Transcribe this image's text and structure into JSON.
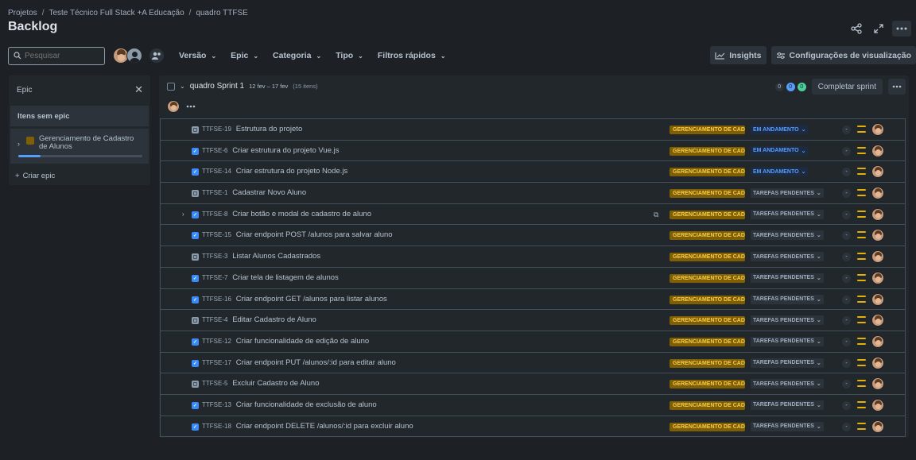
{
  "breadcrumb": [
    "Projetos",
    "Teste Técnico Full Stack +A Educação",
    "quadro TTFSE"
  ],
  "page_title": "Backlog",
  "search": {
    "placeholder": "Pesquisar",
    "value": ""
  },
  "filters": [
    "Versão",
    "Epic",
    "Categoria",
    "Tipo",
    "Filtros rápidos"
  ],
  "toolbar_right": {
    "insights": "Insights",
    "view_settings": "Configurações de visualização"
  },
  "epic_panel": {
    "title": "Epic",
    "no_epic": "Itens sem epic",
    "epics": [
      {
        "name": "Gerenciamento de Cadastro de Alunos",
        "color": "#7f5f01",
        "progress": 0.18
      }
    ],
    "create_label": "Criar epic"
  },
  "sprint": {
    "name": "quadro Sprint 1",
    "dates": "12 fev – 17 fev",
    "count": "(15 itens)",
    "counts": {
      "todo": "0",
      "in_progress": "0",
      "done": "0"
    },
    "complete_label": "Completar sprint"
  },
  "issues": [
    {
      "key": "TTFSE-19",
      "type": "story",
      "summary": "Estrutura do projeto",
      "epic": "GERENCIAMENTO DE CADASTRO DE ALUNOS",
      "status": "EM ANDAMENTO",
      "status_kind": "prog",
      "estimate": "-"
    },
    {
      "key": "TTFSE-6",
      "type": "task",
      "summary": "Criar estrutura do projeto Vue.js",
      "epic": "GERENCIAMENTO DE CADASTRO DE ALUNOS",
      "status": "EM ANDAMENTO",
      "status_kind": "prog",
      "estimate": "-"
    },
    {
      "key": "TTFSE-14",
      "type": "task",
      "summary": "Criar estrutura do projeto Node.js",
      "epic": "GERENCIAMENTO DE CADASTRO DE ALUNOS",
      "status": "EM ANDAMENTO",
      "status_kind": "prog",
      "estimate": "-"
    },
    {
      "key": "TTFSE-1",
      "type": "story",
      "summary": "Cadastrar Novo Aluno",
      "epic": "GERENCIAMENTO DE CADASTRO DE ALUNOS",
      "status": "TAREFAS PENDENTES",
      "status_kind": "todo",
      "estimate": "-"
    },
    {
      "key": "TTFSE-8",
      "type": "task",
      "summary": "Criar botão e modal de cadastro de aluno",
      "epic": "GERENCIAMENTO DE CADASTRO DE ALUNOS",
      "status": "TAREFAS PENDENTES",
      "status_kind": "todo",
      "estimate": "-",
      "expandable": true,
      "has_subtasks": true
    },
    {
      "key": "TTFSE-15",
      "type": "task",
      "summary": "Criar endpoint POST /alunos para salvar aluno",
      "epic": "GERENCIAMENTO DE CADASTRO DE ALUNOS",
      "status": "TAREFAS PENDENTES",
      "status_kind": "todo",
      "estimate": "-"
    },
    {
      "key": "TTFSE-3",
      "type": "story",
      "summary": "Listar Alunos Cadastrados",
      "epic": "GERENCIAMENTO DE CADASTRO DE ALUNOS",
      "status": "TAREFAS PENDENTES",
      "status_kind": "todo",
      "estimate": "-"
    },
    {
      "key": "TTFSE-7",
      "type": "task",
      "summary": "Criar tela de listagem de alunos",
      "epic": "GERENCIAMENTO DE CADASTRO DE ALUNOS",
      "status": "TAREFAS PENDENTES",
      "status_kind": "todo",
      "estimate": "-"
    },
    {
      "key": "TTFSE-16",
      "type": "task",
      "summary": "Criar endpoint GET /alunos para listar alunos",
      "epic": "GERENCIAMENTO DE CADASTRO DE ALUNOS",
      "status": "TAREFAS PENDENTES",
      "status_kind": "todo",
      "estimate": "-"
    },
    {
      "key": "TTFSE-4",
      "type": "story",
      "summary": "Editar Cadastro de Aluno",
      "epic": "GERENCIAMENTO DE CADASTRO DE ALUNOS",
      "status": "TAREFAS PENDENTES",
      "status_kind": "todo",
      "estimate": "-"
    },
    {
      "key": "TTFSE-12",
      "type": "task",
      "summary": "Criar funcionalidade de edição de aluno",
      "epic": "GERENCIAMENTO DE CADASTRO DE ALUNOS",
      "status": "TAREFAS PENDENTES",
      "status_kind": "todo",
      "estimate": "-"
    },
    {
      "key": "TTFSE-17",
      "type": "task",
      "summary": "Criar endpoint PUT /alunos/:id para editar aluno",
      "epic": "GERENCIAMENTO DE CADASTRO DE ALUNOS",
      "status": "TAREFAS PENDENTES",
      "status_kind": "todo",
      "estimate": "-"
    },
    {
      "key": "TTFSE-5",
      "type": "story",
      "summary": "Excluir Cadastro de Aluno",
      "epic": "GERENCIAMENTO DE CADASTRO DE ALUNOS",
      "status": "TAREFAS PENDENTES",
      "status_kind": "todo",
      "estimate": "-"
    },
    {
      "key": "TTFSE-13",
      "type": "task",
      "summary": "Criar funcionalidade de exclusão de aluno",
      "epic": "GERENCIAMENTO DE CADASTRO DE ALUNOS",
      "status": "TAREFAS PENDENTES",
      "status_kind": "todo",
      "estimate": "-"
    },
    {
      "key": "TTFSE-18",
      "type": "task",
      "summary": "Criar endpoint DELETE /alunos/:id para excluir aluno",
      "epic": "GERENCIAMENTO DE CADASTRO DE ALUNOS",
      "status": "TAREFAS PENDENTES",
      "status_kind": "todo",
      "estimate": "-"
    }
  ]
}
